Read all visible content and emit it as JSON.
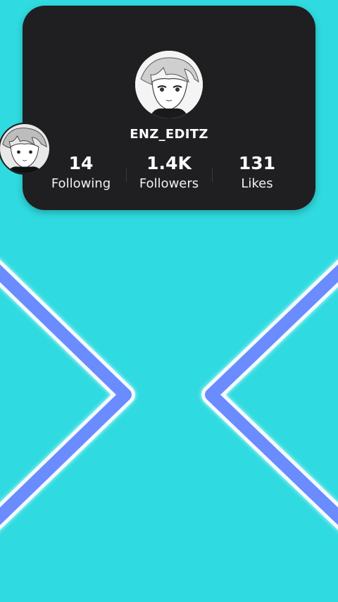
{
  "profile": {
    "username": "ENZ_EDITZ",
    "avatar_icon": "anime-avatar-icon",
    "side_avatar_icon": "anime-avatar-icon"
  },
  "stats": {
    "following": {
      "value": "14",
      "label": "Following"
    },
    "followers": {
      "value": "1.4K",
      "label": "Followers"
    },
    "likes": {
      "value": "131",
      "label": "Likes"
    }
  },
  "colors": {
    "background": "#2fdbe0",
    "card": "#1f1e20",
    "chevron_stroke": "#6b8cff",
    "chevron_glow": "#ffffff"
  },
  "decorations": {
    "left_chevron_icon": "chevron-right-icon",
    "right_chevron_icon": "chevron-left-icon"
  }
}
